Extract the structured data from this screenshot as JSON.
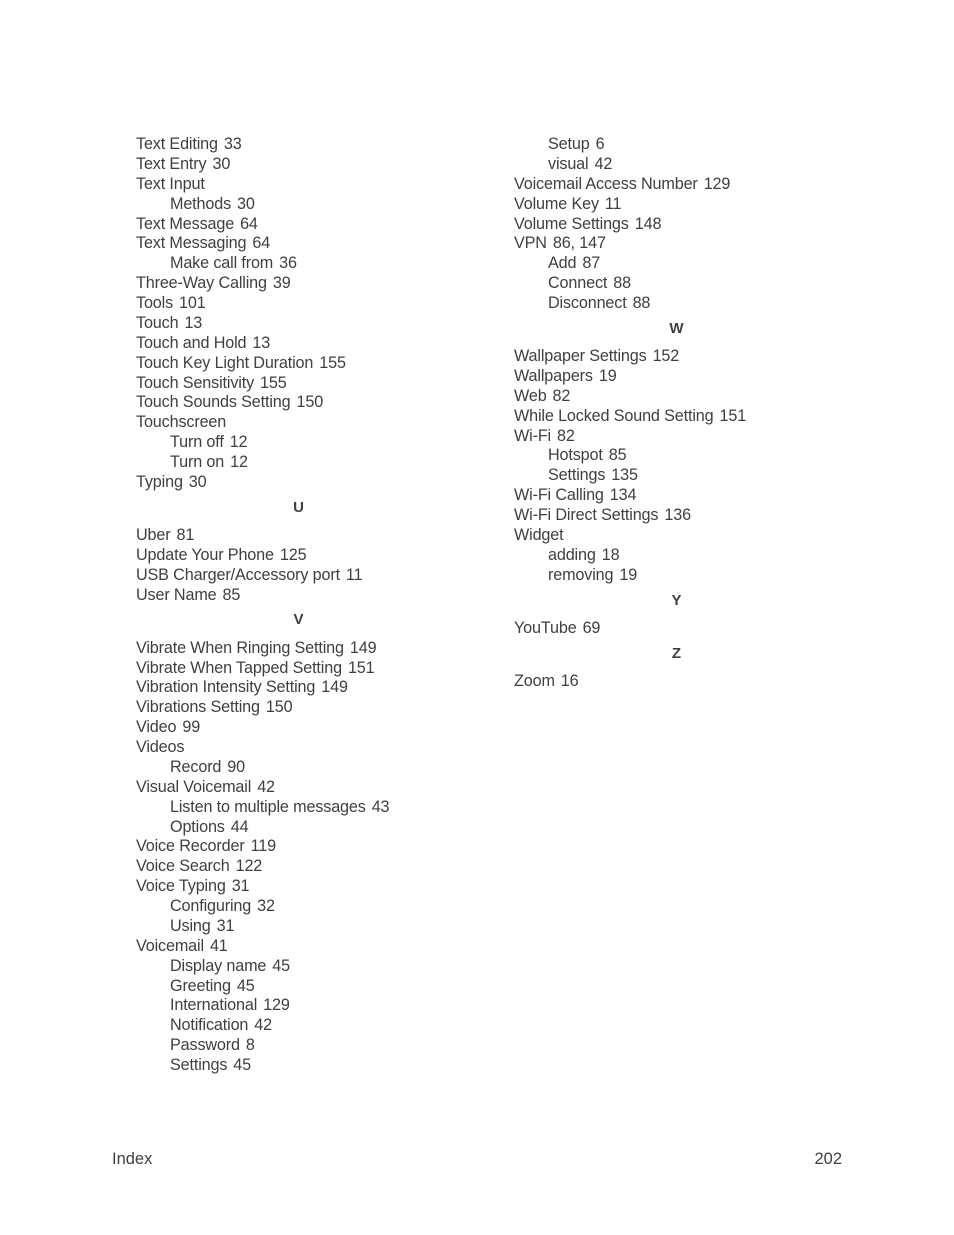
{
  "columns": [
    [
      {
        "t": "entry",
        "label": "Text Editing",
        "pages": "33"
      },
      {
        "t": "entry",
        "label": "Text Entry",
        "pages": "30"
      },
      {
        "t": "entry",
        "label": "Text Input",
        "pages": ""
      },
      {
        "t": "sub",
        "label": "Methods",
        "pages": "30"
      },
      {
        "t": "entry",
        "label": "Text Message",
        "pages": "64"
      },
      {
        "t": "entry",
        "label": "Text Messaging",
        "pages": "64"
      },
      {
        "t": "sub",
        "label": "Make call from",
        "pages": "36"
      },
      {
        "t": "entry",
        "label": "Three-Way Calling",
        "pages": "39"
      },
      {
        "t": "entry",
        "label": "Tools",
        "pages": "101"
      },
      {
        "t": "entry",
        "label": "Touch",
        "pages": "13"
      },
      {
        "t": "entry",
        "label": "Touch and Hold",
        "pages": "13"
      },
      {
        "t": "entry",
        "label": "Touch Key Light Duration",
        "pages": "155"
      },
      {
        "t": "entry",
        "label": "Touch Sensitivity",
        "pages": "155"
      },
      {
        "t": "entry",
        "label": "Touch Sounds Setting",
        "pages": "150"
      },
      {
        "t": "entry",
        "label": "Touchscreen",
        "pages": ""
      },
      {
        "t": "sub",
        "label": "Turn off",
        "pages": "12"
      },
      {
        "t": "sub",
        "label": "Turn on",
        "pages": "12"
      },
      {
        "t": "entry",
        "label": "Typing",
        "pages": "30"
      },
      {
        "t": "header",
        "label": "U"
      },
      {
        "t": "entry",
        "label": "Uber",
        "pages": "81"
      },
      {
        "t": "entry",
        "label": "Update Your Phone",
        "pages": "125"
      },
      {
        "t": "entry",
        "label": "USB Charger/Accessory port",
        "pages": "11"
      },
      {
        "t": "entry",
        "label": "User Name",
        "pages": "85"
      },
      {
        "t": "header",
        "label": "V"
      },
      {
        "t": "entry",
        "label": "Vibrate When Ringing Setting",
        "pages": "149"
      },
      {
        "t": "entry",
        "label": "Vibrate When Tapped Setting",
        "pages": "151"
      },
      {
        "t": "entry",
        "label": "Vibration Intensity Setting",
        "pages": "149"
      },
      {
        "t": "entry",
        "label": "Vibrations Setting",
        "pages": "150"
      },
      {
        "t": "entry",
        "label": "Video",
        "pages": "99"
      },
      {
        "t": "entry",
        "label": "Videos",
        "pages": ""
      },
      {
        "t": "sub",
        "label": "Record",
        "pages": "90"
      },
      {
        "t": "entry",
        "label": "Visual Voicemail",
        "pages": "42"
      },
      {
        "t": "sub",
        "label": "Listen to multiple messages",
        "pages": "43"
      },
      {
        "t": "sub",
        "label": "Options",
        "pages": "44"
      },
      {
        "t": "entry",
        "label": "Voice Recorder",
        "pages": "119"
      },
      {
        "t": "entry",
        "label": "Voice Search",
        "pages": "122"
      },
      {
        "t": "entry",
        "label": "Voice Typing",
        "pages": "31"
      },
      {
        "t": "sub",
        "label": "Configuring",
        "pages": "32"
      },
      {
        "t": "sub",
        "label": "Using",
        "pages": "31"
      },
      {
        "t": "entry",
        "label": "Voicemail",
        "pages": "41"
      },
      {
        "t": "sub",
        "label": "Display name",
        "pages": "45"
      },
      {
        "t": "sub",
        "label": "Greeting",
        "pages": "45"
      },
      {
        "t": "sub",
        "label": "International",
        "pages": "129"
      },
      {
        "t": "sub",
        "label": "Notification",
        "pages": "42"
      },
      {
        "t": "sub",
        "label": "Password",
        "pages": "8"
      },
      {
        "t": "sub",
        "label": "Settings",
        "pages": "45"
      }
    ],
    [
      {
        "t": "sub",
        "label": "Setup",
        "pages": "6"
      },
      {
        "t": "sub",
        "label": "visual",
        "pages": "42"
      },
      {
        "t": "entry",
        "label": "Voicemail Access Number",
        "pages": "129"
      },
      {
        "t": "entry",
        "label": "Volume Key",
        "pages": "11"
      },
      {
        "t": "entry",
        "label": "Volume Settings",
        "pages": "148"
      },
      {
        "t": "entry",
        "label": "VPN",
        "pages": "86, 147"
      },
      {
        "t": "sub",
        "label": "Add",
        "pages": "87"
      },
      {
        "t": "sub",
        "label": "Connect",
        "pages": "88"
      },
      {
        "t": "sub",
        "label": "Disconnect",
        "pages": "88"
      },
      {
        "t": "header",
        "label": "W"
      },
      {
        "t": "entry",
        "label": "Wallpaper Settings",
        "pages": "152"
      },
      {
        "t": "entry",
        "label": "Wallpapers",
        "pages": "19"
      },
      {
        "t": "entry",
        "label": "Web",
        "pages": "82"
      },
      {
        "t": "entry",
        "label": "While Locked Sound Setting",
        "pages": "151"
      },
      {
        "t": "entry",
        "label": "Wi-Fi",
        "pages": "82"
      },
      {
        "t": "sub",
        "label": "Hotspot",
        "pages": "85"
      },
      {
        "t": "sub",
        "label": "Settings",
        "pages": "135"
      },
      {
        "t": "entry",
        "label": "Wi-Fi Calling",
        "pages": "134"
      },
      {
        "t": "entry",
        "label": "Wi-Fi Direct Settings",
        "pages": "136"
      },
      {
        "t": "entry",
        "label": "Widget",
        "pages": ""
      },
      {
        "t": "sub",
        "label": "adding",
        "pages": "18"
      },
      {
        "t": "sub",
        "label": "removing",
        "pages": "19"
      },
      {
        "t": "header",
        "label": "Y"
      },
      {
        "t": "entry",
        "label": "YouTube",
        "pages": "69"
      },
      {
        "t": "header",
        "label": "Z"
      },
      {
        "t": "entry",
        "label": "Zoom",
        "pages": "16"
      }
    ]
  ],
  "footer": {
    "section": "Index",
    "page_number": "202"
  }
}
